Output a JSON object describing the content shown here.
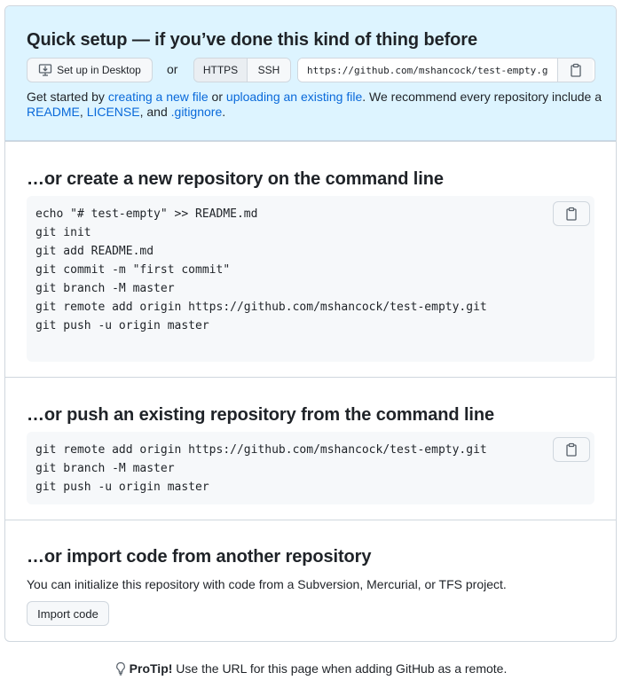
{
  "quick_setup": {
    "title": "Quick setup — if you’ve done this kind of thing before",
    "desktop_button": "Set up in Desktop",
    "or_label": "or",
    "protocols": [
      "HTTPS",
      "SSH"
    ],
    "selected_protocol": "HTTPS",
    "clone_url": "https://github.com/mshancock/test-empty.git",
    "intro_text": {
      "t1": "Get started by ",
      "link_new_file": "creating a new file",
      "t2": " or ",
      "link_upload": "uploading an existing file",
      "t3": ". We recommend every repository include a ",
      "link_readme": "README",
      "t4": ", ",
      "link_license": "LICENSE",
      "t5": ", and ",
      "link_gitignore": ".gitignore",
      "t6": "."
    }
  },
  "create_section": {
    "title": "…or create a new repository on the command line",
    "lines": [
      "echo \"# test-empty\" >> README.md",
      "git init",
      "git add README.md",
      "git commit -m \"first commit\"",
      "git branch -M master",
      "git remote add origin https://github.com/mshancock/test-empty.git",
      "git push -u origin master"
    ]
  },
  "push_section": {
    "title": "…or push an existing repository from the command line",
    "lines": [
      "git remote add origin https://github.com/mshancock/test-empty.git",
      "git branch -M master",
      "git push -u origin master"
    ]
  },
  "import_section": {
    "title": "…or import code from another repository",
    "description": "You can initialize this repository with code from a Subversion, Mercurial, or TFS project.",
    "button": "Import code"
  },
  "protip": {
    "label": "ProTip!",
    "text": " Use the URL for this page when adding GitHub as a remote."
  },
  "icons": {
    "desktop": "desktop-download-icon",
    "copy": "clipboard-icon",
    "tip": "light-bulb-icon"
  }
}
